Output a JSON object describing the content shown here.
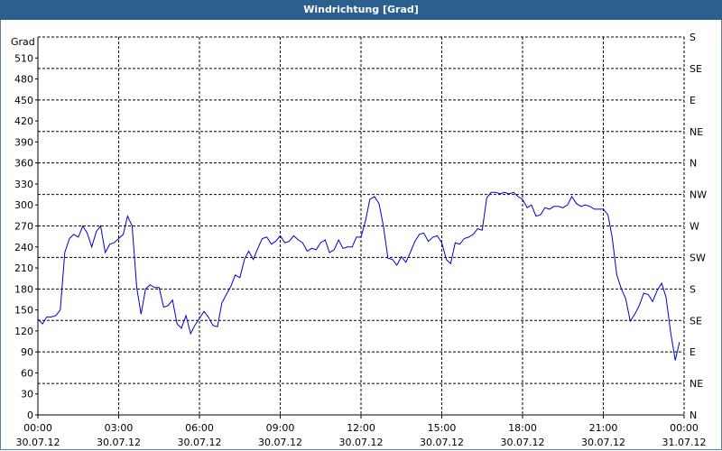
{
  "window": {
    "title": "Windrichtung [Grad]"
  },
  "chart_data": {
    "type": "line",
    "title": "Windrichtung [Grad]",
    "ylabel": "Grad",
    "ylim": [
      0,
      540
    ],
    "yticks": [
      0,
      30,
      60,
      90,
      120,
      150,
      180,
      210,
      240,
      270,
      300,
      330,
      360,
      390,
      420,
      450,
      480,
      510
    ],
    "right_axis_labels": [
      {
        "value": 0,
        "label": "N"
      },
      {
        "value": 45,
        "label": "NE"
      },
      {
        "value": 90,
        "label": "E"
      },
      {
        "value": 135,
        "label": "SE"
      },
      {
        "value": 180,
        "label": "S"
      },
      {
        "value": 225,
        "label": "SW"
      },
      {
        "value": 270,
        "label": "W"
      },
      {
        "value": 315,
        "label": "NW"
      },
      {
        "value": 360,
        "label": "N"
      },
      {
        "value": 405,
        "label": "NE"
      },
      {
        "value": 450,
        "label": "E"
      },
      {
        "value": 495,
        "label": "SE"
      },
      {
        "value": 540,
        "label": "S"
      }
    ],
    "xlim": [
      0,
      24
    ],
    "xticks": [
      {
        "hour": 0,
        "time": "00:00",
        "date": "30.07.12"
      },
      {
        "hour": 3,
        "time": "03:00",
        "date": "30.07.12"
      },
      {
        "hour": 6,
        "time": "06:00",
        "date": "30.07.12"
      },
      {
        "hour": 9,
        "time": "09:00",
        "date": "30.07.12"
      },
      {
        "hour": 12,
        "time": "12:00",
        "date": "30.07.12"
      },
      {
        "hour": 15,
        "time": "15:00",
        "date": "30.07.12"
      },
      {
        "hour": 18,
        "time": "18:00",
        "date": "30.07.12"
      },
      {
        "hour": 21,
        "time": "21:00",
        "date": "30.07.12"
      },
      {
        "hour": 24,
        "time": "00:00",
        "date": "31.07.12"
      }
    ],
    "grid": true,
    "series": [
      {
        "color": "#0000cc",
        "points": [
          [
            0.0,
            137
          ],
          [
            0.17,
            130
          ],
          [
            0.33,
            140
          ],
          [
            0.5,
            140
          ],
          [
            0.67,
            142
          ],
          [
            0.83,
            150
          ],
          [
            1.0,
            232
          ],
          [
            1.17,
            252
          ],
          [
            1.33,
            258
          ],
          [
            1.5,
            254
          ],
          [
            1.67,
            270
          ],
          [
            1.83,
            260
          ],
          [
            2.0,
            240
          ],
          [
            2.17,
            262
          ],
          [
            2.33,
            270
          ],
          [
            2.5,
            232
          ],
          [
            2.67,
            244
          ],
          [
            2.83,
            246
          ],
          [
            3.0,
            252
          ],
          [
            3.17,
            258
          ],
          [
            3.33,
            284
          ],
          [
            3.5,
            270
          ],
          [
            3.67,
            182
          ],
          [
            3.83,
            144
          ],
          [
            4.0,
            180
          ],
          [
            4.17,
            186
          ],
          [
            4.33,
            182
          ],
          [
            4.5,
            182
          ],
          [
            4.67,
            154
          ],
          [
            4.83,
            156
          ],
          [
            5.0,
            164
          ],
          [
            5.17,
            130
          ],
          [
            5.33,
            124
          ],
          [
            5.5,
            142
          ],
          [
            5.67,
            116
          ],
          [
            5.83,
            128
          ],
          [
            6.0,
            138
          ],
          [
            6.17,
            148
          ],
          [
            6.33,
            140
          ],
          [
            6.5,
            128
          ],
          [
            6.67,
            126
          ],
          [
            6.83,
            160
          ],
          [
            7.0,
            172
          ],
          [
            7.17,
            184
          ],
          [
            7.33,
            200
          ],
          [
            7.5,
            196
          ],
          [
            7.67,
            222
          ],
          [
            7.83,
            234
          ],
          [
            8.0,
            222
          ],
          [
            8.17,
            238
          ],
          [
            8.33,
            252
          ],
          [
            8.5,
            254
          ],
          [
            8.67,
            244
          ],
          [
            8.83,
            248
          ],
          [
            9.0,
            256
          ],
          [
            9.17,
            246
          ],
          [
            9.33,
            248
          ],
          [
            9.5,
            256
          ],
          [
            9.67,
            250
          ],
          [
            9.83,
            246
          ],
          [
            10.0,
            234
          ],
          [
            10.17,
            238
          ],
          [
            10.33,
            236
          ],
          [
            10.5,
            246
          ],
          [
            10.67,
            250
          ],
          [
            10.83,
            232
          ],
          [
            11.0,
            236
          ],
          [
            11.17,
            250
          ],
          [
            11.33,
            238
          ],
          [
            11.5,
            240
          ],
          [
            11.67,
            240
          ],
          [
            11.83,
            254
          ],
          [
            12.0,
            254
          ],
          [
            12.17,
            278
          ],
          [
            12.33,
            308
          ],
          [
            12.5,
            312
          ],
          [
            12.67,
            302
          ],
          [
            12.83,
            270
          ],
          [
            13.0,
            224
          ],
          [
            13.17,
            222
          ],
          [
            13.33,
            214
          ],
          [
            13.5,
            226
          ],
          [
            13.67,
            218
          ],
          [
            13.83,
            232
          ],
          [
            14.0,
            248
          ],
          [
            14.17,
            258
          ],
          [
            14.33,
            260
          ],
          [
            14.5,
            248
          ],
          [
            14.67,
            254
          ],
          [
            14.83,
            256
          ],
          [
            15.0,
            246
          ],
          [
            15.17,
            222
          ],
          [
            15.33,
            216
          ],
          [
            15.5,
            246
          ],
          [
            15.67,
            244
          ],
          [
            15.83,
            252
          ],
          [
            16.0,
            254
          ],
          [
            16.17,
            258
          ],
          [
            16.33,
            266
          ],
          [
            16.5,
            264
          ],
          [
            16.67,
            310
          ],
          [
            16.83,
            318
          ],
          [
            17.0,
            318
          ],
          [
            17.17,
            316
          ],
          [
            17.33,
            318
          ],
          [
            17.5,
            316
          ],
          [
            17.67,
            318
          ],
          [
            17.83,
            312
          ],
          [
            18.0,
            308
          ],
          [
            18.17,
            296
          ],
          [
            18.33,
            300
          ],
          [
            18.5,
            284
          ],
          [
            18.67,
            286
          ],
          [
            18.83,
            296
          ],
          [
            19.0,
            294
          ],
          [
            19.17,
            298
          ],
          [
            19.33,
            298
          ],
          [
            19.5,
            296
          ],
          [
            19.67,
            300
          ],
          [
            19.83,
            312
          ],
          [
            20.0,
            302
          ],
          [
            20.17,
            298
          ],
          [
            20.33,
            300
          ],
          [
            20.5,
            298
          ],
          [
            20.67,
            294
          ],
          [
            20.83,
            294
          ],
          [
            21.0,
            294
          ],
          [
            21.17,
            286
          ],
          [
            21.33,
            254
          ],
          [
            21.5,
            200
          ],
          [
            21.67,
            180
          ],
          [
            21.83,
            166
          ],
          [
            22.0,
            134
          ],
          [
            22.17,
            144
          ],
          [
            22.33,
            156
          ],
          [
            22.5,
            174
          ],
          [
            22.67,
            172
          ],
          [
            22.83,
            162
          ],
          [
            23.0,
            178
          ],
          [
            23.17,
            188
          ],
          [
            23.33,
            168
          ],
          [
            23.5,
            118
          ],
          [
            23.67,
            78
          ],
          [
            23.83,
            104
          ]
        ]
      }
    ]
  }
}
